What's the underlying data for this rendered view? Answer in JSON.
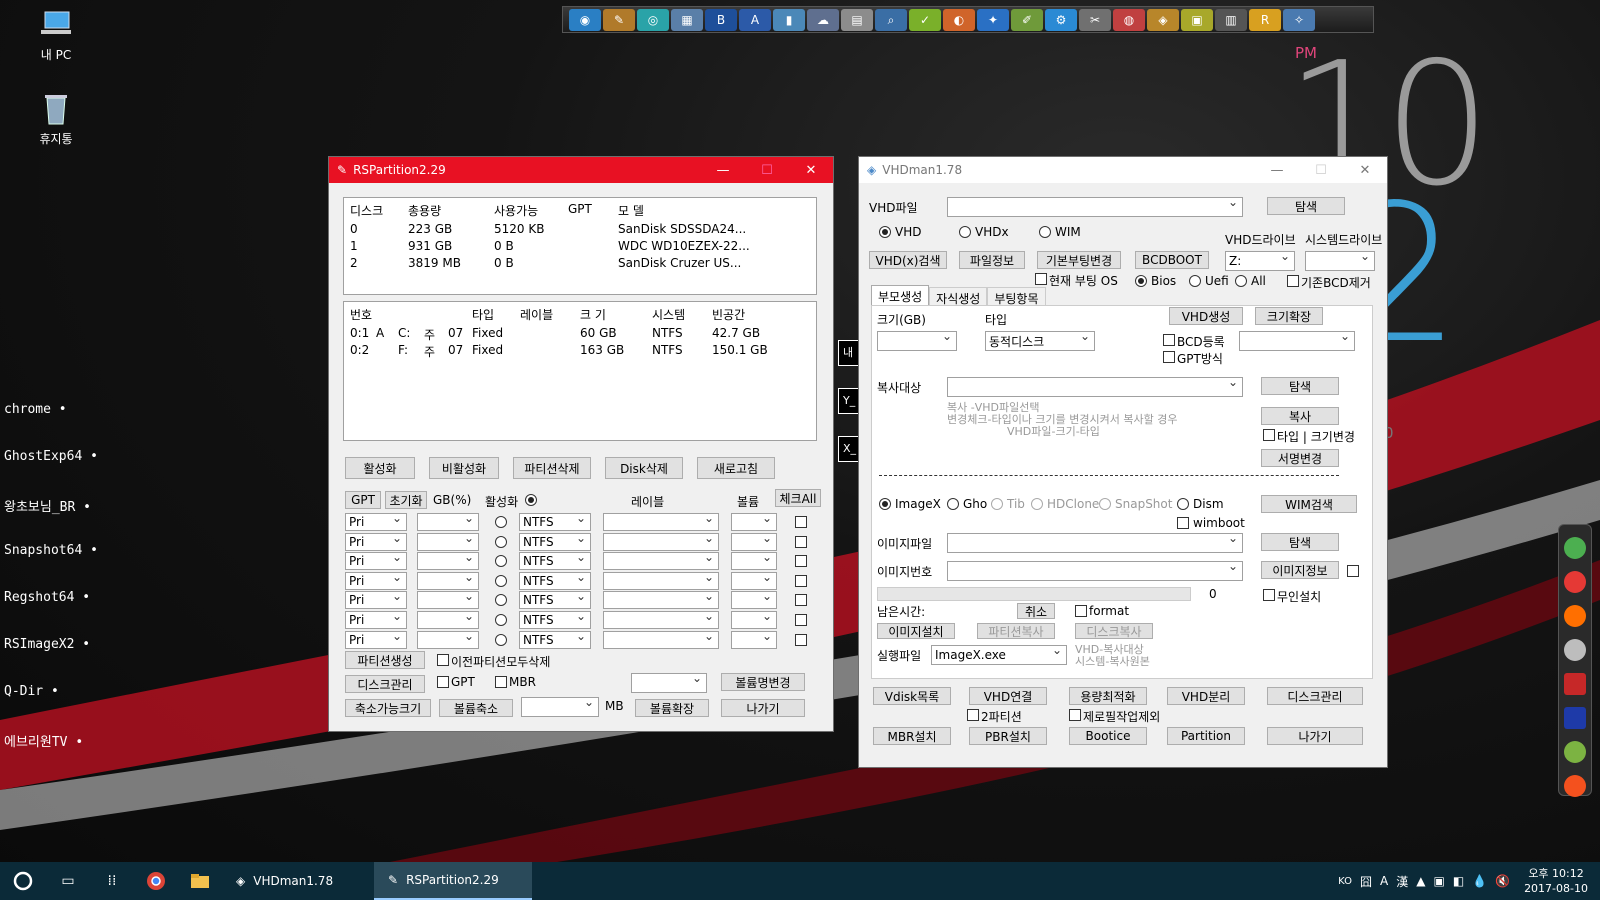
{
  "desktop": {
    "icons": [
      {
        "label": "내 PC"
      },
      {
        "label": "휴지통"
      }
    ],
    "side_links": [
      "chrome •",
      "GhostExp64 •",
      "왕초보님_BR •",
      "Snapshot64 •",
      "Regshot64 •",
      "RSImageX2 •",
      "Q-Dir •",
      "에브리원TV •"
    ],
    "clock": {
      "ampm": "PM",
      "hour": "10",
      "minute": "12"
    },
    "bg_fragment": "0"
  },
  "rspartition": {
    "title": "RSPartition2.29",
    "disk_headers": [
      "디스크",
      "총용량",
      "사용가능",
      "GPT",
      "모  델"
    ],
    "disks": [
      [
        "0",
        "223 GB",
        "5120 KB",
        "",
        "SanDisk SDSSDA24..."
      ],
      [
        "1",
        "931 GB",
        "0 B",
        "",
        "WDC WD10EZEX-22..."
      ],
      [
        "2",
        "3819 MB",
        "0 B",
        "",
        "SanDisk Cruzer US..."
      ]
    ],
    "part_headers": [
      "번호",
      "",
      "",
      "",
      "",
      "타입",
      "레이블",
      "크 기",
      "시스템",
      "빈공간"
    ],
    "parts": [
      [
        "0:1",
        "A",
        "C:",
        "주",
        "07",
        "Fixed",
        "",
        "60 GB",
        "NTFS",
        "42.7 GB"
      ],
      [
        "0:2",
        "",
        "F:",
        "주",
        "07",
        "Fixed",
        "",
        "163 GB",
        "NTFS",
        "150.1 GB"
      ]
    ],
    "buttons": {
      "activate": "활성화",
      "deactivate": "비활성화",
      "delete_partition": "파티션삭제",
      "delete_disk": "Disk삭제",
      "refresh": "새로고침"
    },
    "create_header": {
      "gpt": "GPT",
      "init": "초기화",
      "gb": "GB(%)",
      "active": "활성화",
      "label": "레이블",
      "volume": "볼륨",
      "check_all": "체크All"
    },
    "rows": [
      {
        "type": "Pri",
        "fs": "NTFS"
      },
      {
        "type": "Pri",
        "fs": "NTFS"
      },
      {
        "type": "Pri",
        "fs": "NTFS"
      },
      {
        "type": "Pri",
        "fs": "NTFS"
      },
      {
        "type": "Pri",
        "fs": "NTFS"
      },
      {
        "type": "Pri",
        "fs": "NTFS"
      },
      {
        "type": "Pri",
        "fs": "NTFS"
      }
    ],
    "bottom": {
      "create_partition": "파티션생성",
      "delete_prev": "이전파티션모두삭제",
      "disk_manage": "디스크관리",
      "gpt": "GPT",
      "mbr": "MBR",
      "rename_volume": "볼륨명변경",
      "shrinkable": "축소가능크기",
      "shrink": "볼륨축소",
      "mb": "MB",
      "extend": "볼륨확장",
      "exit": "나가기"
    }
  },
  "vhdman": {
    "title": "VHDman1.78",
    "vhd_file_label": "VHD파일",
    "browse": "탐색",
    "radios": {
      "vhd": "VHD",
      "vhdx": "VHDx",
      "wim": "WIM"
    },
    "vhd_drive_label": "VHD드라이브",
    "sys_drive_label": "시스템드라이브",
    "btn_vhdx_search": "VHD(x)검색",
    "btn_file_info": "파일정보",
    "btn_default_boot": "기본부팅변경",
    "btn_bcdboot": "BCDBOOT",
    "drive_value": "Z:",
    "current_boot": "현재 부팅 OS",
    "boot_radios": {
      "bios": "Bios",
      "uefi": "Uefi",
      "all": "All"
    },
    "remove_bcd": "기존BCD제거",
    "tabs": [
      "부모생성",
      "자식생성",
      "부팅항목"
    ],
    "size_label": "크기(GB)",
    "type_label": "타입",
    "type_value": "동적디스크",
    "btn_vhd_create": "VHD생성",
    "btn_expand": "크기확장",
    "bcd_register": "BCD등록",
    "gpt_mode": "GPT방식",
    "copy_target": "복사대상",
    "copy_hint1": "복사        -VHD파일선택",
    "copy_hint2": "변경체크-타입이나  크기를 변경시켜서 복사할 경우",
    "copy_hint3": "VHD파일-크기-타입",
    "btn_copy": "복사",
    "type_size_change": "타입 | 크기변경",
    "btn_sign": "서명변경",
    "img_radios": {
      "imagex": "ImageX",
      "gho": "Gho",
      "tib": "Tib",
      "hdclone": "HDClone",
      "snapshot": "SnapShot",
      "dism": "Dism"
    },
    "btn_wim_search": "WIM검색",
    "wimboot": "wimboot",
    "image_file": "이미지파일",
    "image_num": "이미지번호",
    "btn_image_info": "이미지정보",
    "progress_value": "0",
    "unattended": "무인설치",
    "time_left": "남은시간:",
    "btn_cancel": "취소",
    "format": "format",
    "btn_image_install": "이미지설치",
    "btn_part_copy": "파티션복사",
    "btn_disk_copy": "디스크복사",
    "exec_file": "실행파일",
    "exec_value": "ImageX.exe",
    "exec_hint1": "VHD-복사대상",
    "exec_hint2": "시스템-복사원본",
    "btn_vdisk_list": "Vdisk목록",
    "btn_vhd_connect": "VHD연결",
    "btn_optimize": "용량최적화",
    "btn_vhd_detach": "VHD분리",
    "btn_disk_manage": "디스크관리",
    "two_partition": "2파티션",
    "exclude_zero": "제로필작업제외",
    "btn_mbr": "MBR설치",
    "btn_pbr": "PBR설치",
    "btn_bootice": "Bootice",
    "btn_partition": "Partition",
    "btn_exit": "나가기"
  },
  "taskbar": {
    "apps": [
      {
        "label": "VHDman1.78"
      },
      {
        "label": "RSPartition2.29"
      }
    ],
    "tray": {
      "lang": "KO",
      "time": "오후 10:12",
      "date": "2017-08-10"
    }
  },
  "colors": {
    "rs_title": "#e81123",
    "taskbar": "#0b2a38",
    "clock_accent": "#3a9ed4",
    "pm": "#e0457b"
  }
}
